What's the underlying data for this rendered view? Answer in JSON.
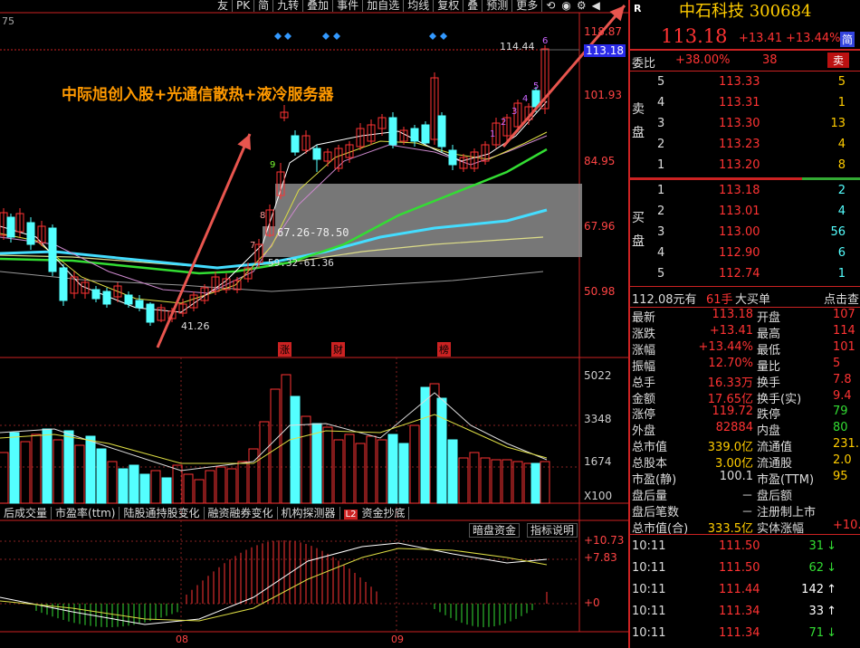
{
  "toolbar": {
    "items": [
      "友",
      "PK",
      "简",
      "九转",
      "叠加",
      "事件",
      "加自选",
      "均线",
      "复权",
      "叠",
      "预测",
      "更多"
    ]
  },
  "chart": {
    "top_left_label": "75",
    "annotation": "中际旭创入股+光通信散热+液冷服务器",
    "high_label": "114.44",
    "low_label": "41.26",
    "box_label_1": "67.26-78.50",
    "box_label_2": "59.32-61.36",
    "price_axis": [
      "118.87",
      "113.18",
      "101.93",
      "84.95",
      "67.96",
      "50.98"
    ],
    "event_markers": [
      "涨",
      "财",
      "榜"
    ],
    "count_marks": [
      "1",
      "2",
      "3",
      "4",
      "5",
      "6",
      "7",
      "8",
      "9"
    ],
    "count_left": [
      "9",
      "8",
      "7"
    ],
    "volume_axis": [
      "5022",
      "3348",
      "1674",
      "X100"
    ],
    "indicator_tabs": [
      "后成交量",
      "市盈率(ttm)",
      "陆股通持股变化",
      "融资融券变化",
      "机构探测器",
      "资金抄底"
    ],
    "indicator_tab_badge": "L2",
    "sub_buttons": [
      "暗盘资金",
      "指标说明"
    ],
    "macd_axis": [
      "+10.73",
      "+7.83",
      "+0"
    ],
    "date_labels": [
      "08",
      "09"
    ]
  },
  "colors": {
    "up": "#ff3333",
    "down": "#54ffff",
    "accent": "#ffcc00",
    "annotation": "#ff9900",
    "arrow": "#e8554e"
  },
  "quote": {
    "marker": "R",
    "name_code": "中石科技 300684",
    "price": "113.18",
    "change": "+13.41",
    "change_pct": "+13.44%",
    "badge": "简",
    "webi_label": "委比",
    "webi_value": "+38.00%",
    "webi_diff": "38",
    "sell_btn": "卖",
    "sell_side": [
      "卖",
      "盘"
    ],
    "buy_side": [
      "买",
      "盘"
    ],
    "sell": [
      {
        "lvl": "5",
        "price": "113.33",
        "vol": "5"
      },
      {
        "lvl": "4",
        "price": "113.31",
        "vol": "1"
      },
      {
        "lvl": "3",
        "price": "113.30",
        "vol": "13"
      },
      {
        "lvl": "2",
        "price": "113.23",
        "vol": "4"
      },
      {
        "lvl": "1",
        "price": "113.20",
        "vol": "8"
      }
    ],
    "buy": [
      {
        "lvl": "1",
        "price": "113.18",
        "vol": "2"
      },
      {
        "lvl": "2",
        "price": "113.01",
        "vol": "4"
      },
      {
        "lvl": "3",
        "price": "113.00",
        "vol": "56"
      },
      {
        "lvl": "4",
        "price": "112.90",
        "vol": "6"
      },
      {
        "lvl": "5",
        "price": "112.74",
        "vol": "1"
      }
    ],
    "big_order": {
      "price": "112.08元有",
      "hands": "61手",
      "label": "大买单",
      "action": "点击查"
    },
    "stats": [
      {
        "l1": "最新",
        "v1": "113.18",
        "l2": "开盘",
        "v2": "107"
      },
      {
        "l1": "涨跌",
        "v1": "+13.41",
        "l2": "最高",
        "v2": "114"
      },
      {
        "l1": "涨幅",
        "v1": "+13.44%",
        "l2": "最低",
        "v2": "101"
      },
      {
        "l1": "振幅",
        "v1": "12.70%",
        "l2": "量比",
        "v2": "5"
      },
      {
        "l1": "总手",
        "v1": "16.33万",
        "l2": "换手",
        "v2": "7.8"
      },
      {
        "l1": "金额",
        "v1": "17.65亿",
        "l2": "换手(实)",
        "v2": "9.4"
      },
      {
        "l1": "涨停",
        "v1": "119.72",
        "l2": "跌停",
        "v2": "79"
      },
      {
        "l1": "外盘",
        "v1": "82884",
        "l2": "内盘",
        "v2": "80"
      },
      {
        "l1": "总市值",
        "v1": "339.0亿",
        "l2": "流通值",
        "v2": "231."
      },
      {
        "l1": "总股本",
        "v1": "3.00亿",
        "l2": "流通股",
        "v2": "2.0"
      },
      {
        "l1": "市盈(静)",
        "v1": "100.1",
        "l2": "市盈(TTM)",
        "v2": "95"
      },
      {
        "l1": "盘后量",
        "v1": "－",
        "l2": "盘后额",
        "v2": ""
      },
      {
        "l1": "盘后笔数",
        "v1": "－",
        "l2": "注册制上市",
        "v2": ""
      },
      {
        "l1": "总市值(合)",
        "v1": "333.5亿",
        "l2": "实体涨幅",
        "v2": "+10.9"
      }
    ],
    "ticks": [
      {
        "time": "10:11",
        "price": "111.50",
        "vol": "31",
        "dir": "down"
      },
      {
        "time": "10:11",
        "price": "111.50",
        "vol": "62",
        "dir": "down"
      },
      {
        "time": "10:11",
        "price": "111.44",
        "vol": "142",
        "dir": "up"
      },
      {
        "time": "10:11",
        "price": "111.34",
        "vol": "33",
        "dir": "up"
      },
      {
        "time": "10:11",
        "price": "111.34",
        "vol": "71",
        "dir": "down"
      }
    ]
  }
}
